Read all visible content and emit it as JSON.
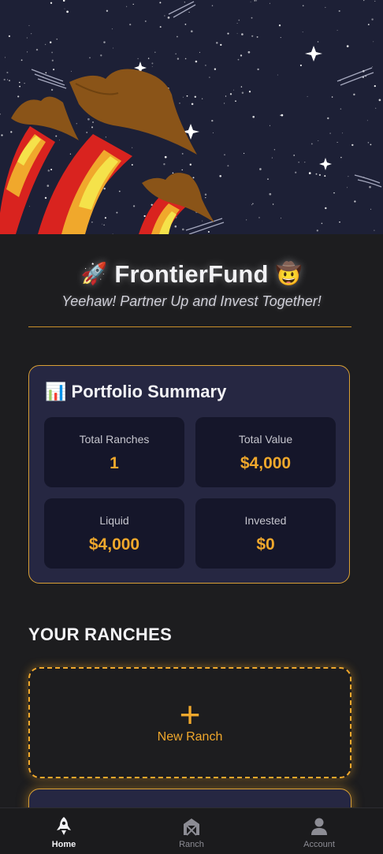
{
  "app": {
    "brand_rocket": "🚀",
    "brand_name": "FrontierFund",
    "brand_cowboy": "🤠",
    "tagline": "Yeehaw! Partner Up and Invest Together!"
  },
  "portfolio": {
    "icon": "📊",
    "title": "Portfolio Summary",
    "stats": [
      {
        "label": "Total Ranches",
        "value": "1"
      },
      {
        "label": "Total Value",
        "value": "$4,000"
      },
      {
        "label": "Liquid",
        "value": "$4,000"
      },
      {
        "label": "Invested",
        "value": "$0"
      }
    ]
  },
  "ranches": {
    "title": "YOUR RANCHES",
    "new_plus": "+",
    "new_label": "New Ranch"
  },
  "nav": {
    "items": [
      {
        "label": "Home",
        "icon": "rocket-icon",
        "active": true
      },
      {
        "label": "Ranch",
        "icon": "barn-icon",
        "active": false
      },
      {
        "label": "Account",
        "icon": "person-icon",
        "active": false
      }
    ]
  },
  "colors": {
    "accent": "#f0a82c",
    "background": "#1d1d1f",
    "card": "#262742",
    "stat_tile": "#15162a",
    "hero_sky": "#1d2036"
  }
}
